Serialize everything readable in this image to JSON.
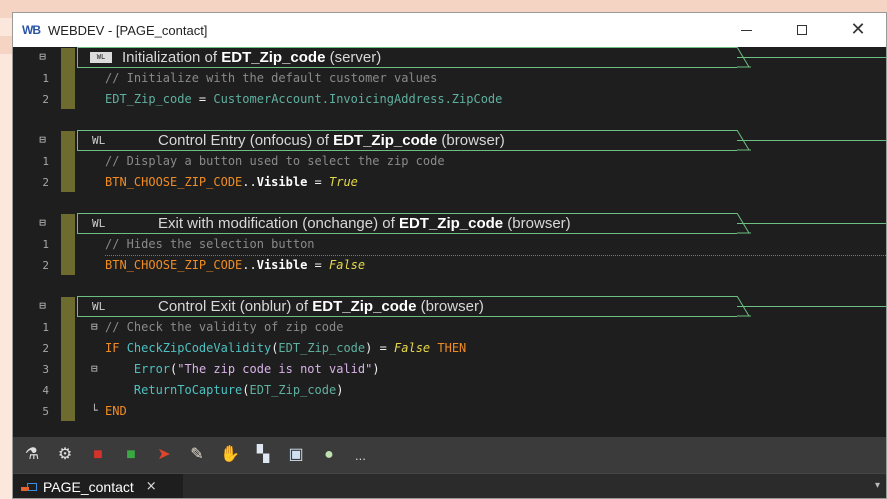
{
  "window": {
    "app_logo": "WB",
    "title": "WEBDEV - [PAGE_contact]"
  },
  "sections": [
    {
      "tag": "WL",
      "header_prefix": "Initialization of ",
      "header_name": "EDT_Zip_code",
      "header_suffix": " (server)",
      "lines": [
        {
          "n": "1",
          "parts": [
            [
              "cmt",
              "// Initialize with the default customer values"
            ]
          ]
        },
        {
          "n": "2",
          "parts": [
            [
              "id",
              "EDT_Zip_code"
            ],
            [
              "wt",
              " = "
            ],
            [
              "id",
              "CustomerAccount.InvoicingAddress.ZipCode"
            ]
          ]
        }
      ]
    },
    {
      "tag": "WL",
      "header_prefix": "Control Entry (onfocus) of ",
      "header_name": "EDT_Zip_code",
      "header_suffix": " (browser)",
      "lines": [
        {
          "n": "1",
          "parts": [
            [
              "cmt",
              "// Display a button used to select the zip code"
            ]
          ]
        },
        {
          "n": "2",
          "parts": [
            [
              "kw",
              "BTN_CHOOSE_ZIP_CODE"
            ],
            [
              "wt",
              ".."
            ],
            [
              "prop",
              "Visible"
            ],
            [
              "wt",
              " = "
            ],
            [
              "lit",
              "True"
            ]
          ]
        }
      ]
    },
    {
      "tag": "WL",
      "header_prefix": "Exit with modification (onchange) of ",
      "header_name": "EDT_Zip_code",
      "header_suffix": " (browser)",
      "lines": [
        {
          "n": "1",
          "parts": [
            [
              "cmt",
              "// Hides the selection button"
            ]
          ]
        },
        {
          "n": "2",
          "parts": [
            [
              "kw",
              "BTN_CHOOSE_ZIP_CODE"
            ],
            [
              "wt",
              ".."
            ],
            [
              "prop",
              "Visible"
            ],
            [
              "wt",
              " = "
            ],
            [
              "lit",
              "False"
            ]
          ]
        }
      ]
    },
    {
      "tag": "WL",
      "header_prefix": "Control Exit (onblur) of ",
      "header_name": "EDT_Zip_code",
      "header_suffix": " (browser)",
      "lines": [
        {
          "n": "1",
          "parts": [
            [
              "cmt",
              "// Check the validity of zip code"
            ]
          ]
        },
        {
          "n": "2",
          "parts": [
            [
              "kw",
              "IF "
            ],
            [
              "fn",
              "CheckZipCodeValidity"
            ],
            [
              "wt",
              "("
            ],
            [
              "id",
              "EDT_Zip_code"
            ],
            [
              "wt",
              ") = "
            ],
            [
              "lit",
              "False"
            ],
            [
              "kw",
              " THEN"
            ]
          ]
        },
        {
          "n": "3",
          "parts": [
            [
              "wt",
              "    "
            ],
            [
              "fn",
              "Error"
            ],
            [
              "wt",
              "("
            ],
            [
              "str",
              "\"The zip code is not valid\""
            ],
            [
              "wt",
              ")"
            ]
          ]
        },
        {
          "n": "4",
          "parts": [
            [
              "wt",
              "    "
            ],
            [
              "fn",
              "ReturnToCapture"
            ],
            [
              "wt",
              "("
            ],
            [
              "id",
              "EDT_Zip_code"
            ],
            [
              "wt",
              ")"
            ]
          ]
        },
        {
          "n": "5",
          "parts": [
            [
              "kw",
              "END"
            ]
          ]
        }
      ]
    }
  ],
  "toolbar": {
    "icons": [
      "debug-run-icon",
      "debug-step-icon",
      "red-stop-icon",
      "green-page-icon",
      "red-arrow-icon",
      "tool-icon",
      "hand-icon",
      "select-icon",
      "window-icon",
      "go-icon"
    ],
    "more_label": "..."
  },
  "tab": {
    "label": "PAGE_contact",
    "close": "×"
  }
}
